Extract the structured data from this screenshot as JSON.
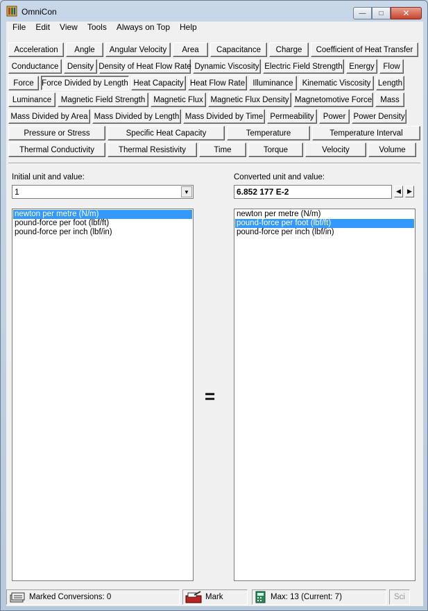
{
  "window": {
    "title": "OmniCon"
  },
  "menu": [
    "File",
    "Edit",
    "View",
    "Tools",
    "Always on Top",
    "Help"
  ],
  "categories": [
    [
      "Acceleration",
      "Angle",
      "Angular Velocity",
      "Area",
      "Capacitance",
      "Charge",
      "Coefficient of Heat Transfer"
    ],
    [
      "Conductance",
      "Density",
      "Density of Heat Flow Rate",
      "Dynamic Viscosity",
      "Electric Field Strength",
      "Energy",
      "Flow"
    ],
    [
      "Force",
      "Force Divided by Length",
      "Heat Capacity",
      "Heat Flow Rate",
      "Illuminance",
      "Kinematic Viscosity",
      "Length"
    ],
    [
      "Luminance",
      "Magnetic Field Strength",
      "Magnetic Flux",
      "Magnetic Flux Density",
      "Magnetomotive Force",
      "Mass"
    ],
    [
      "Mass Divided by Area",
      "Mass Divided by Length",
      "Mass Divided by Time",
      "Permeability",
      "Power",
      "Power Density"
    ],
    [
      "Pressure or Stress",
      "Specific Heat Capacity",
      "Temperature",
      "Temperature Interval"
    ],
    [
      "Thermal Conductivity",
      "Thermal Resistivity",
      "Time",
      "Torque",
      "Velocity",
      "Volume"
    ]
  ],
  "selected_category": "Force Divided by Length",
  "initial": {
    "label": "Initial unit and value:",
    "value": "1",
    "units": [
      "newton per metre (N/m)",
      "pound-force per foot (lbf/ft)",
      "pound-force per inch (lbf/in)"
    ],
    "selected_index": 0
  },
  "converted": {
    "label": "Converted unit and value:",
    "value": "6.852 177 E-2",
    "units": [
      "newton per metre (N/m)",
      "pound-force per foot (lbf/ft)",
      "pound-force per inch (lbf/in)"
    ],
    "selected_index": 1
  },
  "equals": "=",
  "status": {
    "marked": "Marked Conversions: 0",
    "mark": "Mark",
    "max": "Max: 13 (Current: 7)",
    "sci": "Sci"
  }
}
